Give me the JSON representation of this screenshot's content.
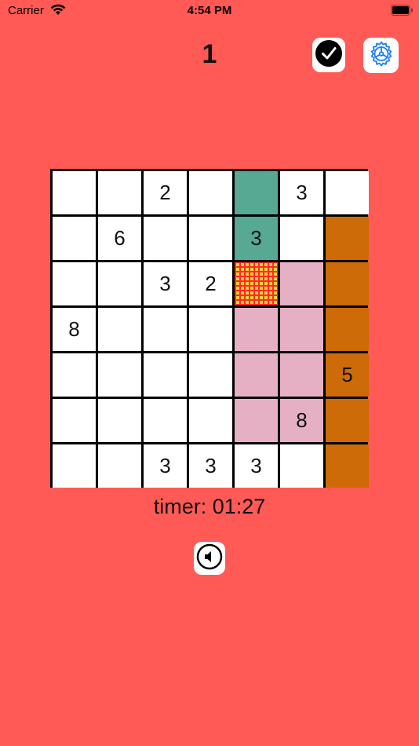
{
  "status_bar": {
    "carrier": "Carrier",
    "time": "4:54 PM"
  },
  "header": {
    "level": "1"
  },
  "icons": {
    "check": "checkmark-circle-icon",
    "settings": "gear-icon",
    "sound": "speaker-icon"
  },
  "colors": {
    "background": "#FF5A55",
    "teal": "#58A994",
    "pink": "#E6B0C4",
    "orange": "#CC6B07",
    "selected": "#FFD238"
  },
  "board": {
    "rows": [
      [
        {
          "v": "",
          "c": ""
        },
        {
          "v": "",
          "c": ""
        },
        {
          "v": "2",
          "c": ""
        },
        {
          "v": "",
          "c": ""
        },
        {
          "v": "",
          "c": "teal"
        },
        {
          "v": "3",
          "c": ""
        },
        {
          "v": "",
          "c": ""
        }
      ],
      [
        {
          "v": "",
          "c": ""
        },
        {
          "v": "6",
          "c": ""
        },
        {
          "v": "",
          "c": ""
        },
        {
          "v": "",
          "c": ""
        },
        {
          "v": "3",
          "c": "teal"
        },
        {
          "v": "",
          "c": ""
        },
        {
          "v": "",
          "c": "orange"
        }
      ],
      [
        {
          "v": "",
          "c": ""
        },
        {
          "v": "",
          "c": ""
        },
        {
          "v": "3",
          "c": ""
        },
        {
          "v": "2",
          "c": ""
        },
        {
          "v": "",
          "c": "selected"
        },
        {
          "v": "",
          "c": "pink"
        },
        {
          "v": "",
          "c": "orange"
        }
      ],
      [
        {
          "v": "8",
          "c": ""
        },
        {
          "v": "",
          "c": ""
        },
        {
          "v": "",
          "c": ""
        },
        {
          "v": "",
          "c": ""
        },
        {
          "v": "",
          "c": "pink"
        },
        {
          "v": "",
          "c": "pink"
        },
        {
          "v": "",
          "c": "orange"
        }
      ],
      [
        {
          "v": "",
          "c": ""
        },
        {
          "v": "",
          "c": ""
        },
        {
          "v": "",
          "c": ""
        },
        {
          "v": "",
          "c": ""
        },
        {
          "v": "",
          "c": "pink"
        },
        {
          "v": "",
          "c": "pink"
        },
        {
          "v": "5",
          "c": "orange"
        }
      ],
      [
        {
          "v": "",
          "c": ""
        },
        {
          "v": "",
          "c": ""
        },
        {
          "v": "",
          "c": ""
        },
        {
          "v": "",
          "c": ""
        },
        {
          "v": "",
          "c": "pink"
        },
        {
          "v": "8",
          "c": "pink"
        },
        {
          "v": "",
          "c": "orange"
        }
      ],
      [
        {
          "v": "",
          "c": ""
        },
        {
          "v": "",
          "c": ""
        },
        {
          "v": "3",
          "c": ""
        },
        {
          "v": "3",
          "c": ""
        },
        {
          "v": "3",
          "c": ""
        },
        {
          "v": "",
          "c": ""
        },
        {
          "v": "",
          "c": "orange"
        }
      ]
    ]
  },
  "timer": {
    "text": "timer: 01:27"
  }
}
